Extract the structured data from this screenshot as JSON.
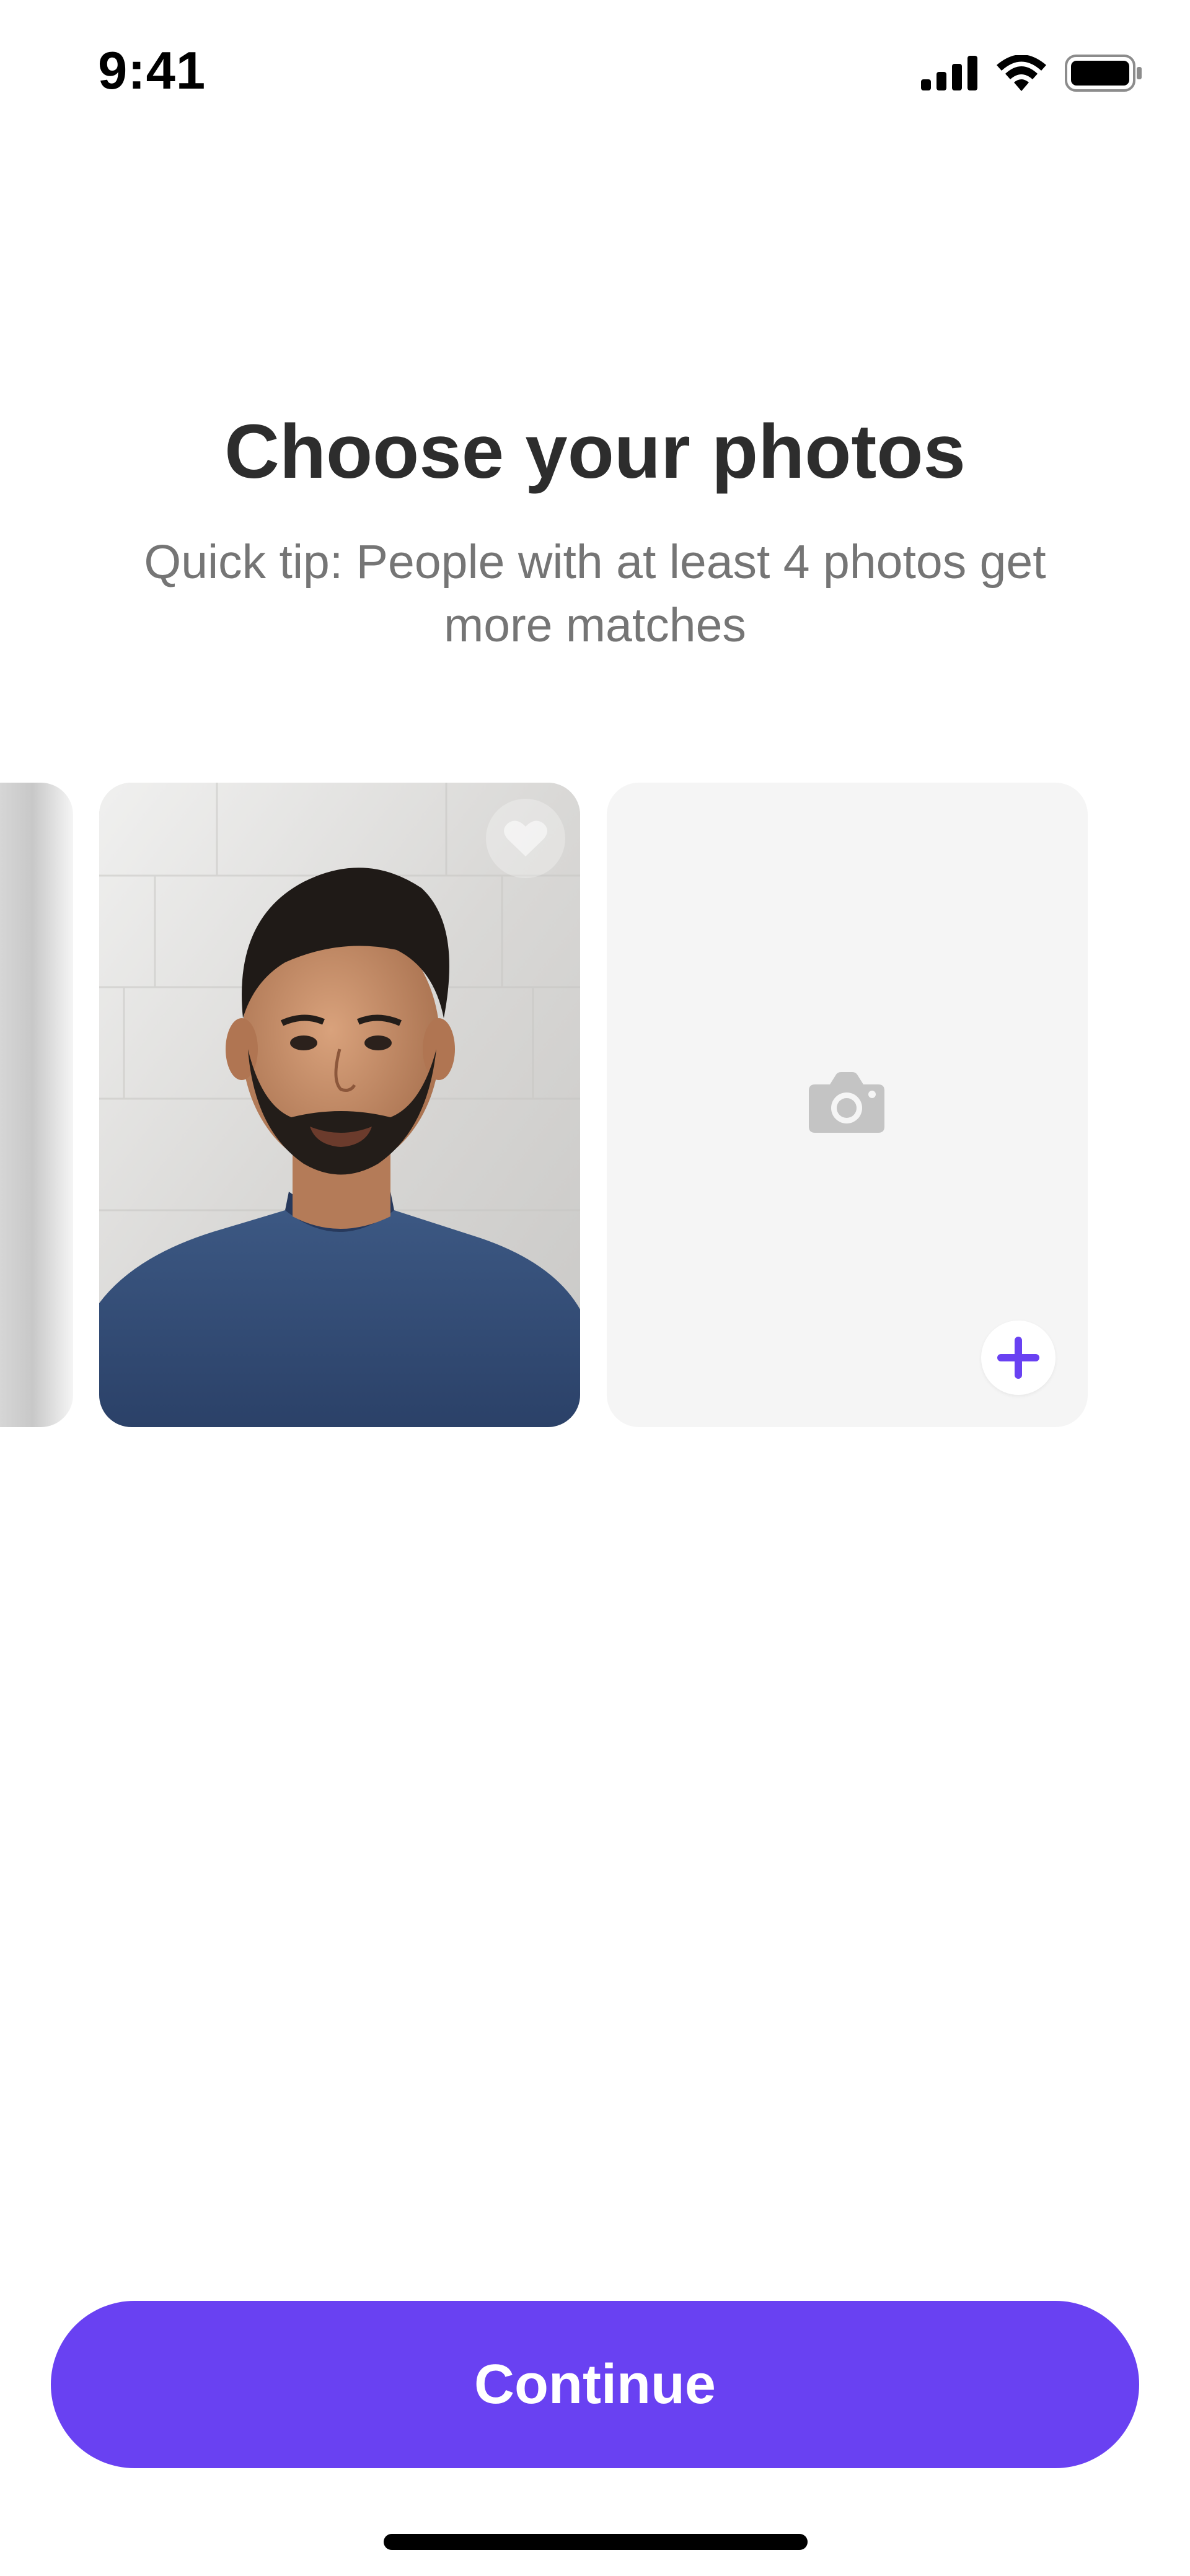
{
  "status_bar": {
    "time": "9:41",
    "icons": [
      "cellular-signal-icon",
      "wifi-icon",
      "battery-icon"
    ]
  },
  "header": {
    "title": "Choose your photos",
    "subtitle": "Quick tip: People with at least 4 photos get more matches"
  },
  "photos": {
    "cards": [
      {
        "kind": "partial-previous-photo"
      },
      {
        "kind": "photo",
        "badge": "heart-badge-icon"
      },
      {
        "kind": "empty-slot",
        "placeholder_icon": "camera-icon",
        "action_icon": "plus-icon"
      }
    ]
  },
  "footer": {
    "continue_label": "Continue"
  },
  "colors": {
    "accent": "#6941f2",
    "title": "#2d2d2d",
    "subtitle": "#757575",
    "empty_slot": "#f5f5f5",
    "placeholder_icon": "#c4c4c4"
  }
}
